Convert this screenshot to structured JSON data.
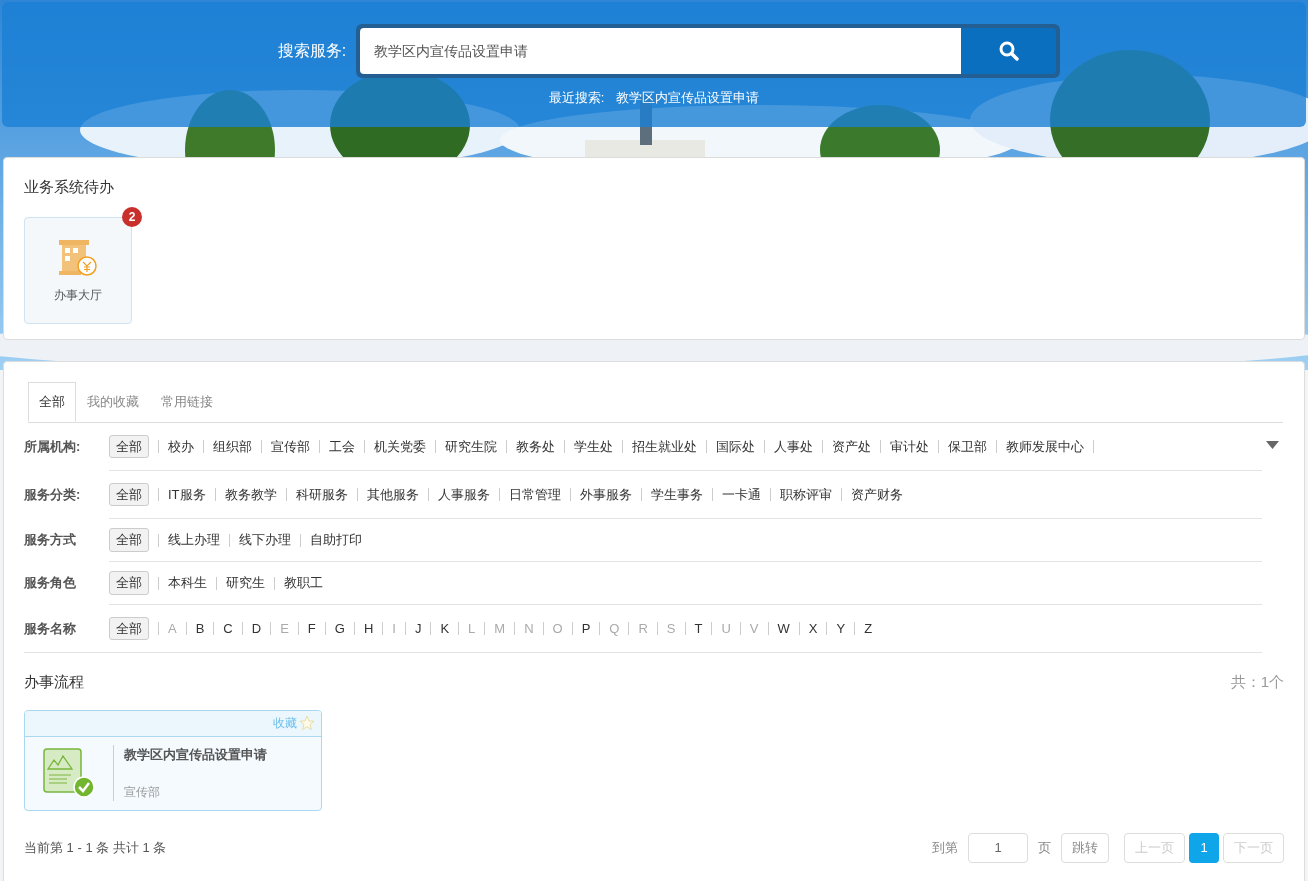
{
  "search": {
    "label": "搜索服务:",
    "value": "教学区内宣传品设置申请",
    "recent_label": "最近搜索:",
    "recent": "教学区内宣传品设置申请"
  },
  "todo": {
    "title": "业务系统待办",
    "items": [
      {
        "label": "办事大厅",
        "badge": "2"
      }
    ]
  },
  "tabs": [
    {
      "label": "全部",
      "selected": true
    },
    {
      "label": "我的收藏",
      "selected": false
    },
    {
      "label": "常用链接",
      "selected": false
    }
  ],
  "filters": [
    {
      "label": "所属机构:",
      "expandable": true,
      "items": [
        {
          "label": "全部",
          "selected": true,
          "disabled": false
        },
        {
          "label": "校办",
          "selected": false,
          "disabled": false
        },
        {
          "label": "组织部",
          "selected": false,
          "disabled": false
        },
        {
          "label": "宣传部",
          "selected": false,
          "disabled": false
        },
        {
          "label": "工会",
          "selected": false,
          "disabled": false
        },
        {
          "label": "机关党委",
          "selected": false,
          "disabled": false
        },
        {
          "label": "研究生院",
          "selected": false,
          "disabled": false
        },
        {
          "label": "教务处",
          "selected": false,
          "disabled": false
        },
        {
          "label": "学生处",
          "selected": false,
          "disabled": false
        },
        {
          "label": "招生就业处",
          "selected": false,
          "disabled": false
        },
        {
          "label": "国际处",
          "selected": false,
          "disabled": false
        },
        {
          "label": "人事处",
          "selected": false,
          "disabled": false
        },
        {
          "label": "资产处",
          "selected": false,
          "disabled": false
        },
        {
          "label": "审计处",
          "selected": false,
          "disabled": false
        },
        {
          "label": "保卫部",
          "selected": false,
          "disabled": false
        },
        {
          "label": "教师发展中心",
          "selected": false,
          "disabled": false
        }
      ]
    },
    {
      "label": "服务分类:",
      "expandable": false,
      "items": [
        {
          "label": "全部",
          "selected": true,
          "disabled": false
        },
        {
          "label": "IT服务",
          "selected": false,
          "disabled": false
        },
        {
          "label": "教务教学",
          "selected": false,
          "disabled": false
        },
        {
          "label": "科研服务",
          "selected": false,
          "disabled": false
        },
        {
          "label": "其他服务",
          "selected": false,
          "disabled": false
        },
        {
          "label": "人事服务",
          "selected": false,
          "disabled": false
        },
        {
          "label": "日常管理",
          "selected": false,
          "disabled": false
        },
        {
          "label": "外事服务",
          "selected": false,
          "disabled": false
        },
        {
          "label": "学生事务",
          "selected": false,
          "disabled": false
        },
        {
          "label": "一卡通",
          "selected": false,
          "disabled": false
        },
        {
          "label": "职称评审",
          "selected": false,
          "disabled": false
        },
        {
          "label": "资产财务",
          "selected": false,
          "disabled": false
        }
      ]
    },
    {
      "label": "服务方式",
      "expandable": false,
      "items": [
        {
          "label": "全部",
          "selected": true,
          "disabled": false
        },
        {
          "label": "线上办理",
          "selected": false,
          "disabled": false
        },
        {
          "label": "线下办理",
          "selected": false,
          "disabled": false
        },
        {
          "label": "自助打印",
          "selected": false,
          "disabled": false
        }
      ]
    },
    {
      "label": "服务角色",
      "expandable": false,
      "items": [
        {
          "label": "全部",
          "selected": true,
          "disabled": false
        },
        {
          "label": "本科生",
          "selected": false,
          "disabled": false
        },
        {
          "label": "研究生",
          "selected": false,
          "disabled": false
        },
        {
          "label": "教职工",
          "selected": false,
          "disabled": false
        }
      ]
    },
    {
      "label": "服务名称",
      "expandable": false,
      "items": [
        {
          "label": "全部",
          "selected": true,
          "disabled": false
        },
        {
          "label": "A",
          "selected": false,
          "disabled": true
        },
        {
          "label": "B",
          "selected": false,
          "disabled": false
        },
        {
          "label": "C",
          "selected": false,
          "disabled": false
        },
        {
          "label": "D",
          "selected": false,
          "disabled": false
        },
        {
          "label": "E",
          "selected": false,
          "disabled": true
        },
        {
          "label": "F",
          "selected": false,
          "disabled": false
        },
        {
          "label": "G",
          "selected": false,
          "disabled": false
        },
        {
          "label": "H",
          "selected": false,
          "disabled": false
        },
        {
          "label": "I",
          "selected": false,
          "disabled": true
        },
        {
          "label": "J",
          "selected": false,
          "disabled": false
        },
        {
          "label": "K",
          "selected": false,
          "disabled": false
        },
        {
          "label": "L",
          "selected": false,
          "disabled": true
        },
        {
          "label": "M",
          "selected": false,
          "disabled": true
        },
        {
          "label": "N",
          "selected": false,
          "disabled": true
        },
        {
          "label": "O",
          "selected": false,
          "disabled": true
        },
        {
          "label": "P",
          "selected": false,
          "disabled": false
        },
        {
          "label": "Q",
          "selected": false,
          "disabled": true
        },
        {
          "label": "R",
          "selected": false,
          "disabled": true
        },
        {
          "label": "S",
          "selected": false,
          "disabled": true
        },
        {
          "label": "T",
          "selected": false,
          "disabled": false
        },
        {
          "label": "U",
          "selected": false,
          "disabled": true
        },
        {
          "label": "V",
          "selected": false,
          "disabled": true
        },
        {
          "label": "W",
          "selected": false,
          "disabled": false
        },
        {
          "label": "X",
          "selected": false,
          "disabled": false
        },
        {
          "label": "Y",
          "selected": false,
          "disabled": false
        },
        {
          "label": "Z",
          "selected": false,
          "disabled": false
        }
      ]
    }
  ],
  "process": {
    "title": "办事流程",
    "count": "共：1个",
    "cards": [
      {
        "favorite_label": "收藏",
        "favorited": false,
        "title": "教学区内宣传品设置申请",
        "department": "宣传部"
      }
    ]
  },
  "pagination": {
    "summary": "当前第 1 - 1 条 共计 1 条",
    "goto_label": "到第",
    "page_input": "1",
    "page_unit": "页",
    "jump": "跳转",
    "prev": {
      "label": "上一页",
      "disabled": true
    },
    "pages": [
      {
        "label": "1",
        "selected": true
      }
    ],
    "next": {
      "label": "下一页",
      "disabled": true
    }
  }
}
